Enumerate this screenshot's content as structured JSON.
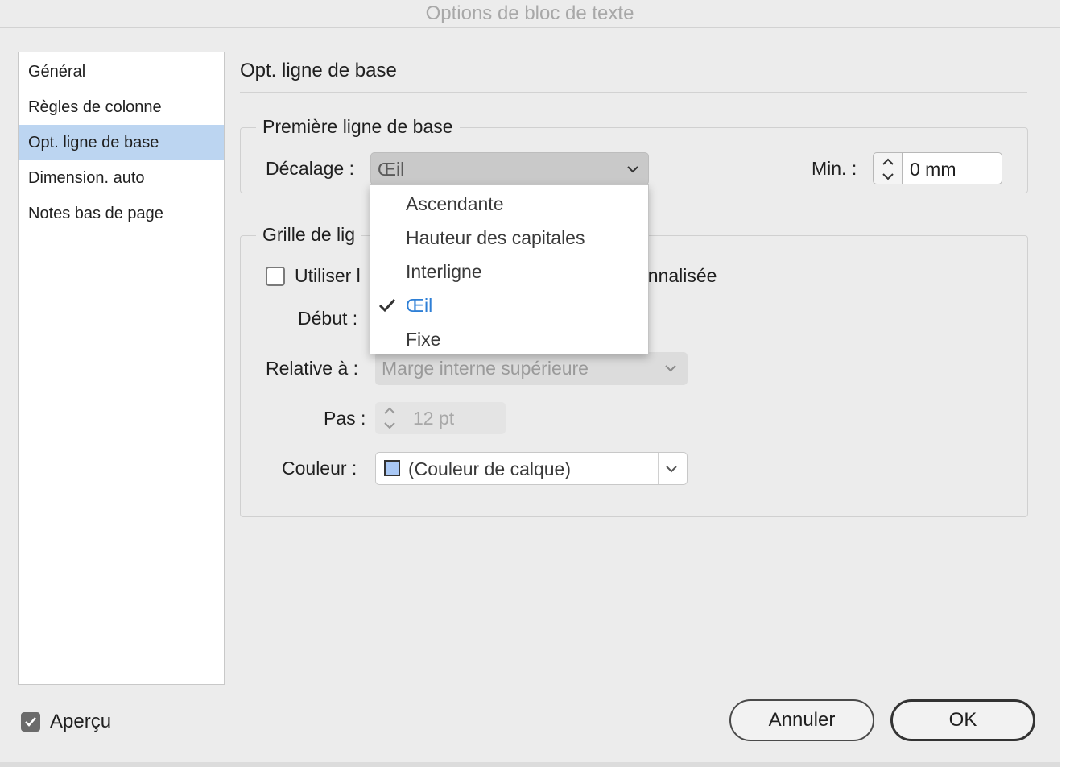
{
  "window": {
    "title": "Options de bloc de texte"
  },
  "sidebar": {
    "items": [
      {
        "label": "Général"
      },
      {
        "label": "Règles de colonne"
      },
      {
        "label": "Opt. ligne de base",
        "selected": true
      },
      {
        "label": "Dimension. auto"
      },
      {
        "label": "Notes bas de page"
      }
    ]
  },
  "main": {
    "section_title": "Opt. ligne de base",
    "first_baseline": {
      "group_label": "Première ligne de base",
      "offset_label": "Décalage :",
      "offset_value": "Œil",
      "min_label": "Min. :",
      "min_value": "0 mm"
    },
    "grid": {
      "group_label": "Grille de lig",
      "use_custom_checkbox_label_start": "Utiliser l",
      "use_custom_checkbox_label_end": "onnalisée",
      "use_custom_checked": false,
      "start_label": "Début :",
      "relative_label": "Relative à :",
      "relative_value": "Marge interne supérieure",
      "step_label": "Pas :",
      "step_value": "12 pt",
      "color_label": "Couleur :",
      "color_value": "(Couleur de calque)",
      "color_swatch": "#a9c8f5"
    },
    "offset_dropdown": {
      "options": [
        {
          "label": "Ascendante",
          "checked": false
        },
        {
          "label": "Hauteur des capitales",
          "checked": false
        },
        {
          "label": "Interligne",
          "checked": false
        },
        {
          "label": "Œil",
          "checked": true
        },
        {
          "label": "Fixe",
          "checked": false
        }
      ]
    }
  },
  "footer": {
    "preview_label": "Aperçu",
    "preview_checked": true,
    "cancel_label": "Annuler",
    "ok_label": "OK"
  },
  "colors": {
    "accent": "#2e7fd6",
    "selection": "#bcd5f1",
    "checkbox_checked": "#6b6b6b"
  }
}
